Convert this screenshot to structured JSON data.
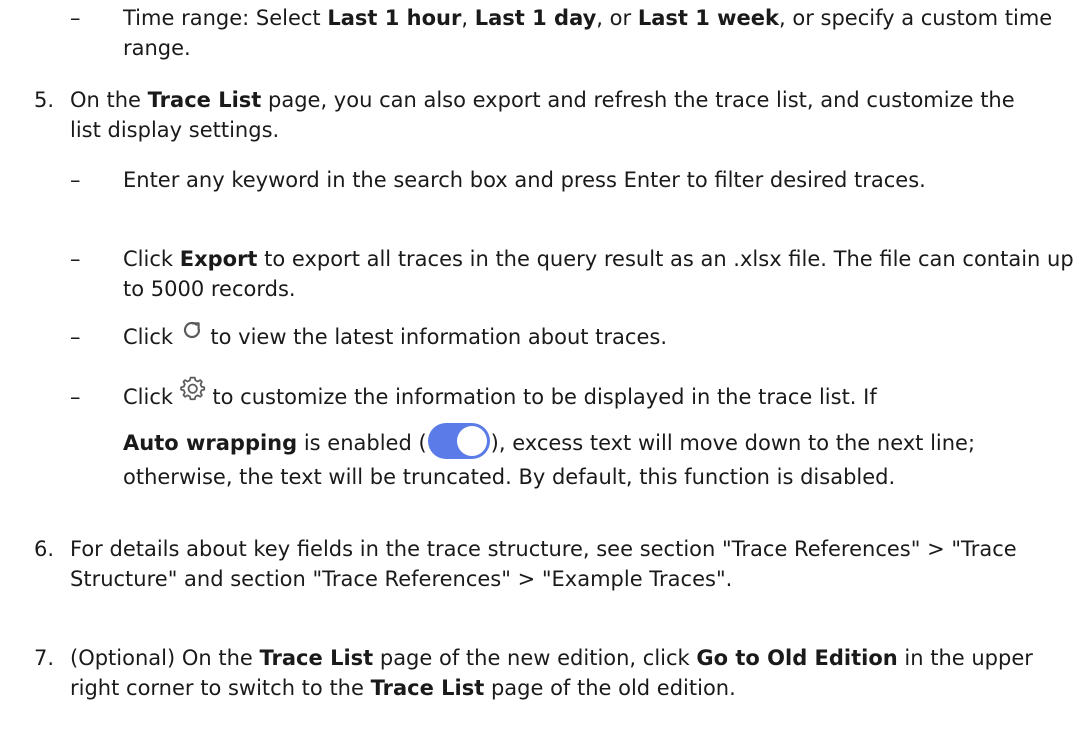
{
  "item_time_range": {
    "dash": "–",
    "lead": "Time range: Select ",
    "opt1": "Last 1 hour",
    "sep1": ", ",
    "opt2": "Last 1 day",
    "sep2": ", or ",
    "opt3": "Last 1 week",
    "tail": ", or specify a custom time range."
  },
  "step5": {
    "num": "5.",
    "lead": "On the ",
    "page": "Trace List",
    "tail": " page, you can also export and refresh the trace list, and customize the list display settings."
  },
  "step5_search": {
    "dash": "–",
    "text": "Enter any keyword in the search box and press Enter to filter desired traces."
  },
  "step5_export": {
    "dash": "–",
    "lead": "Click ",
    "button": "Export",
    "tail": " to export all traces in the query result as an .xlsx file. The file can contain up to 5000 records."
  },
  "step5_refresh": {
    "dash": "–",
    "lead": "Click ",
    "icon": "refresh-icon",
    "tail": " to view the latest information about traces."
  },
  "step5_settings": {
    "dash": "–",
    "lead": "Click ",
    "icon": "gear-icon",
    "tail1": " to customize the information to be displayed in the trace list. If",
    "option": "Auto wrapping",
    "mid": " is enabled (",
    "toggle_icon": "toggle-on-icon",
    "tail2": "), excess text will move down to the next line; otherwise, the text will be truncated. By default, this function is disabled."
  },
  "step6": {
    "num": "6.",
    "text": "For details about key fields in the trace structure, see section \"Trace References\" > \"Trace Structure\" and section \"Trace References\" > \"Example Traces\"."
  },
  "step7": {
    "num": "7.",
    "lead": "(Optional) On the ",
    "page1": "Trace List",
    "mid1": " page of the new edition, click ",
    "button": "Go to Old Edition",
    "mid2": " in the upper right corner to switch to the ",
    "page2": "Trace List",
    "tail": " page of the old edition."
  },
  "colors": {
    "text": "#1a1a1a",
    "icon": "#5a5a5a",
    "toggle": "#5b7be8"
  }
}
